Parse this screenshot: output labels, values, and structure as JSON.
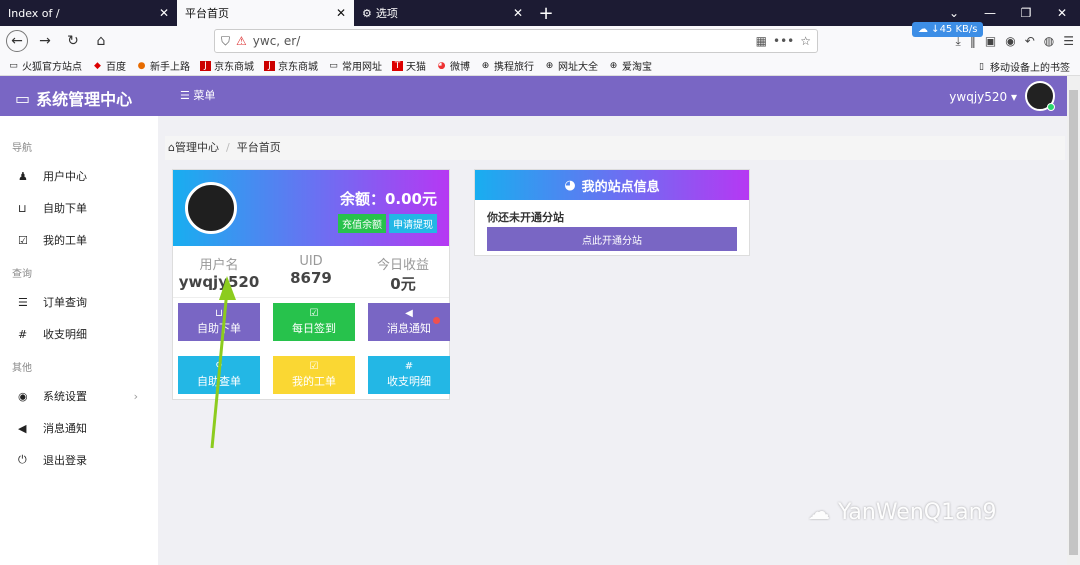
{
  "browser": {
    "tabs": [
      {
        "title": "Index of /"
      },
      {
        "title": "平台首页"
      },
      {
        "title": "选项"
      }
    ],
    "url": "ywc,                       er/",
    "speed": "45 KB/s",
    "bookmarks": [
      "火狐官方站点",
      "百度",
      "新手上路",
      "京东商城",
      "京东商城",
      "常用网址",
      "天猫",
      "微博",
      "携程旅行",
      "网址大全",
      "爱淘宝"
    ],
    "mobile_bookmarks": "移动设备上的书签"
  },
  "header": {
    "logo": "系统管理中心",
    "menu": "菜单",
    "username": "ywqjy520 ▾"
  },
  "sidebar": {
    "sec_nav": "导航",
    "sec_query": "查询",
    "sec_other": "其他",
    "items": [
      "用户中心",
      "自助下单",
      "我的工单",
      "订单查询",
      "收支明细",
      "系统设置",
      "消息通知",
      "退出登录"
    ]
  },
  "breadcrumb": {
    "home": "管理中心",
    "current": "平台首页"
  },
  "account": {
    "balance": "余额：0.00元",
    "recharge": "充值余额",
    "withdraw": "申请提现",
    "stats": [
      {
        "label": "用户名",
        "value": "ywqjy520"
      },
      {
        "label": "UID",
        "value": "8679"
      },
      {
        "label": "今日收益",
        "value": "0元"
      }
    ],
    "buttons": [
      "自助下单",
      "每日签到",
      "消息通知",
      "自助查单",
      "我的工单",
      "收支明细"
    ]
  },
  "site": {
    "title": "我的站点信息",
    "status": "你还未开通分站",
    "open_button": "点此开通分站"
  },
  "watermark": "YanWenQ1an9",
  "colors": {
    "accent": "#7966c4",
    "green": "#27c24c",
    "cyan": "#23b7e5",
    "yellow": "#fad733",
    "arrow": "#8ccc1e"
  }
}
